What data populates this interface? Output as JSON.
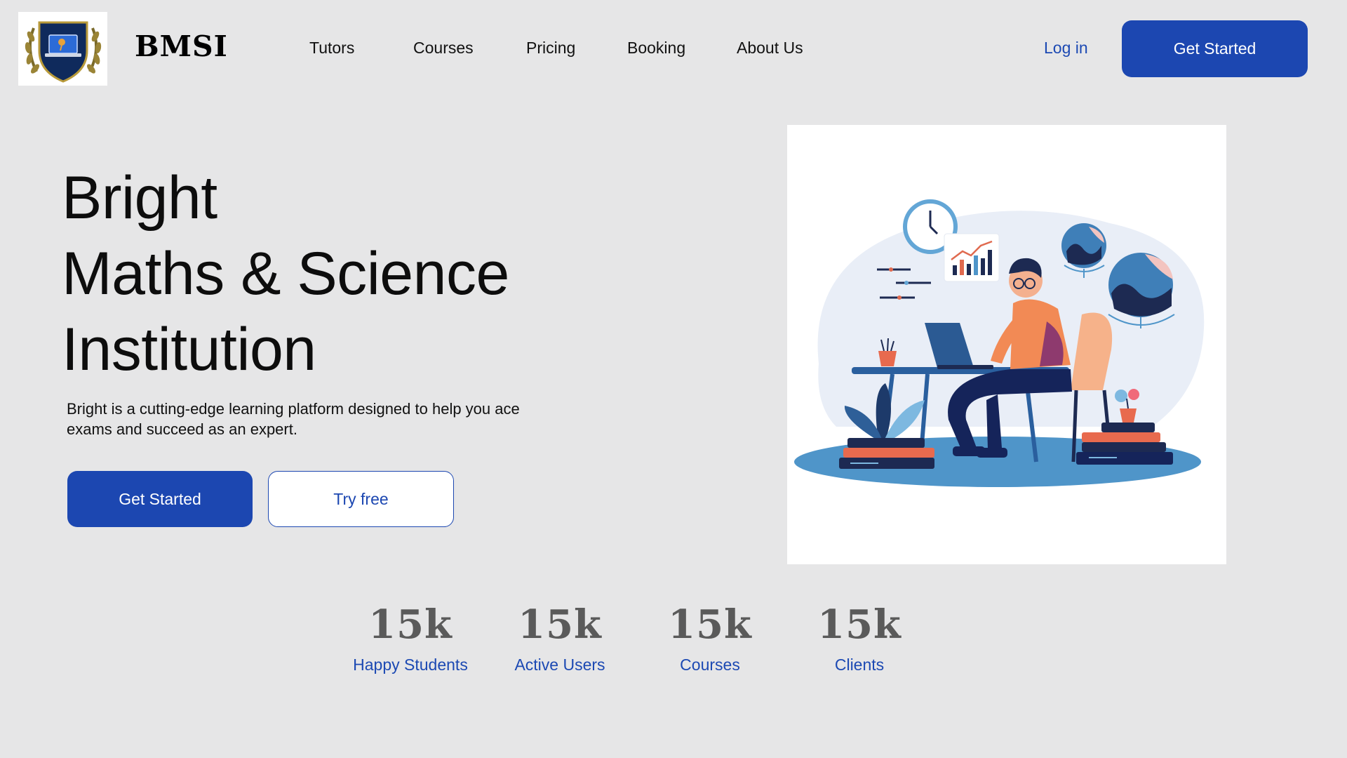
{
  "brand": {
    "name": "BMSI",
    "logo_icon": "institution-crest-icon"
  },
  "nav": {
    "items": [
      "Tutors",
      "Courses",
      "Pricing",
      "Booking",
      "About Us"
    ],
    "login_label": "Log in",
    "cta_label": "Get Started"
  },
  "hero": {
    "title_lines": [
      "Bright",
      "Maths & Science",
      "Institution"
    ],
    "description": "Bright is a cutting-edge learning platform designed to help you ace exams and succeed as an expert.",
    "primary_label": "Get Started",
    "secondary_label": "Try free",
    "illustration": "student-studying-at-laptop-illustration"
  },
  "stats": [
    {
      "value": "15k",
      "label": "Happy Students"
    },
    {
      "value": "15k",
      "label": "Active Users"
    },
    {
      "value": "15k",
      "label": "Courses"
    },
    {
      "value": "15k",
      "label": "Clients"
    }
  ],
  "colors": {
    "background": "#e6e6e7",
    "accent": "#1c47b1",
    "link": "#1c49b3",
    "stat_value": "#5a5a5a"
  }
}
